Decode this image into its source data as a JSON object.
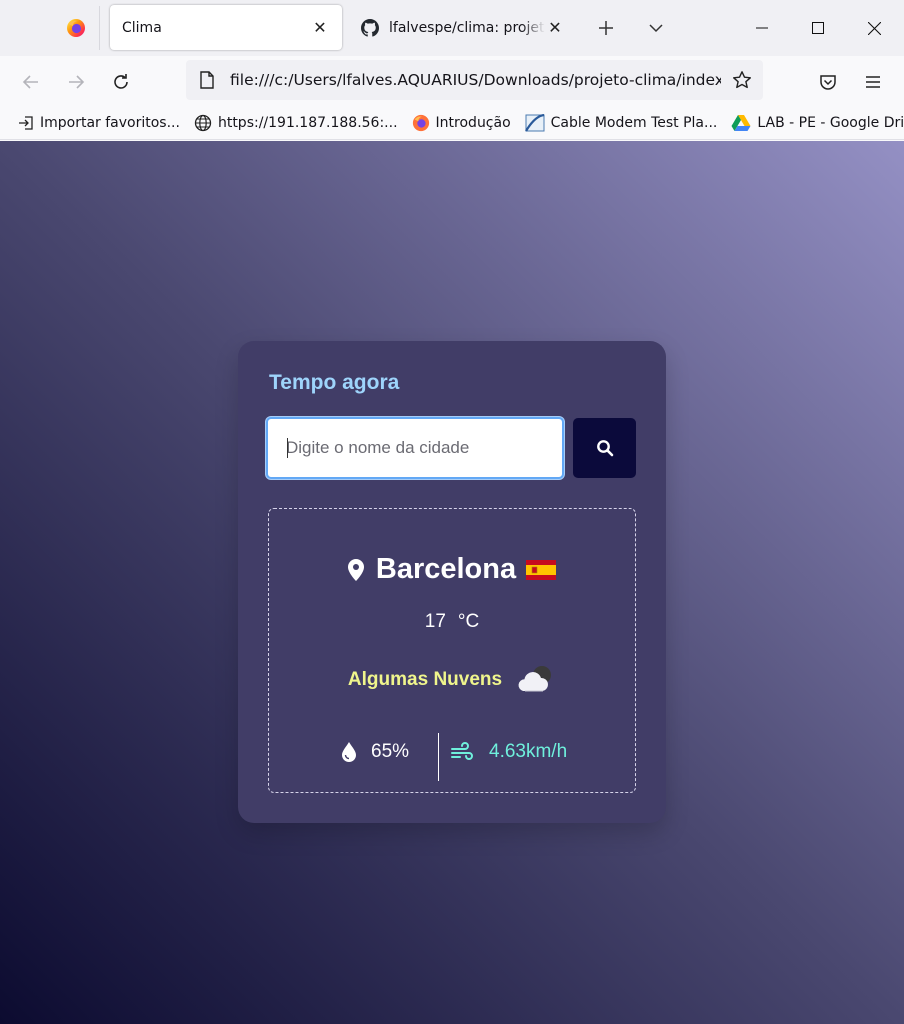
{
  "browser": {
    "tabs": [
      {
        "label": "Clima",
        "active": true
      },
      {
        "label": "lfalvespe/clima: projeto de",
        "active": false
      }
    ],
    "url": "file:///c:/Users/lfalves.AQUARIUS/Downloads/projeto-clima/index.html",
    "bookmarks": [
      {
        "label": "Importar favoritos...",
        "icon": "import-icon"
      },
      {
        "label": "https://191.187.188.56:...",
        "icon": "globe-icon"
      },
      {
        "label": "Introdução",
        "icon": "firefox-icon"
      },
      {
        "label": "Cable Modem Test Pla...",
        "icon": "modem-icon"
      },
      {
        "label": "LAB - PE - Google Drive",
        "icon": "google-drive-icon"
      }
    ]
  },
  "app": {
    "title": "Tempo agora",
    "search": {
      "placeholder": "Digite o nome da cidade",
      "value": ""
    },
    "weather": {
      "city": "Barcelona",
      "country_flag": "spain-flag",
      "temperature": "17",
      "unit": "°C",
      "description": "Algumas Nuvens",
      "description_icon": "few-clouds-night-icon",
      "humidity": "65%",
      "wind": "4.63km/h"
    },
    "colors": {
      "title": "#9ed4fb",
      "description": "#eff58c",
      "wind": "#6ff0dc",
      "card": "#413d67",
      "search_button": "#0b0a3b"
    }
  }
}
